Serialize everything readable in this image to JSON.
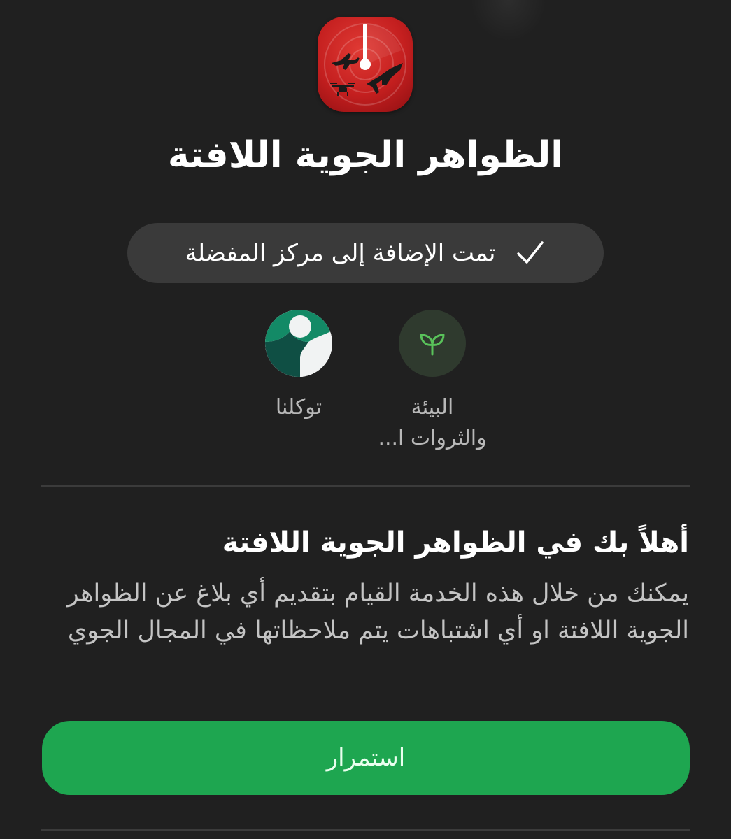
{
  "app": {
    "name": "الظواهر الجوية اللافتة",
    "icon": "radar-drone-app-icon",
    "icon_color": "#c41f1f"
  },
  "favorites_notice": {
    "icon": "checkmark-icon",
    "text": "تمت الإضافة إلى مركز المفضلة"
  },
  "shortcuts": [
    {
      "label_line1": "البيئة",
      "label_line2": "والثروات ا...",
      "icon": "sprout-icon",
      "color": "#2f3a2e"
    },
    {
      "label_line1": "توكلنا",
      "icon": "tawakkalna-logo-icon",
      "color": "#0f6b55"
    }
  ],
  "welcome": {
    "title": "أهلاً بك في الظواهر الجوية اللافتة",
    "body": "يمكنك من خلال هذه الخدمة القيام بتقديم أي بلاغ عن الظواهر الجوية اللافتة او أي اشتباهات يتم ملاحظاتها في المجال الجوي"
  },
  "actions": {
    "continue_label": "استمرار",
    "continue_color": "#1ea650"
  }
}
